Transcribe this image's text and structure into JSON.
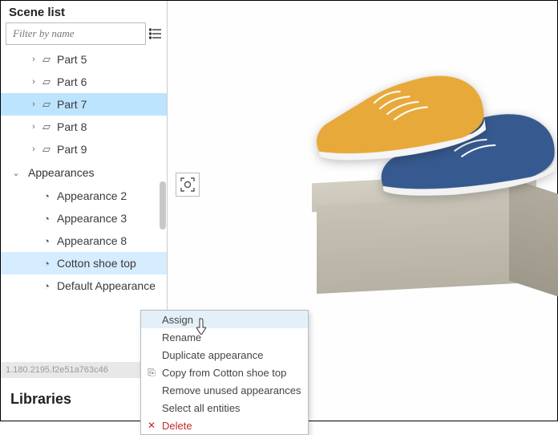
{
  "sidebar": {
    "title": "Scene list",
    "filter_placeholder": "Filter by name",
    "parts": [
      {
        "label": "Part 5"
      },
      {
        "label": "Part 6"
      },
      {
        "label": "Part 7",
        "selected": true
      },
      {
        "label": "Part 8"
      },
      {
        "label": "Part 9"
      }
    ],
    "appearances_header": "Appearances",
    "appearances": [
      {
        "label": "Appearance 2"
      },
      {
        "label": "Appearance 3"
      },
      {
        "label": "Appearance 8"
      },
      {
        "label": "Cotton shoe top",
        "selected": true
      },
      {
        "label": "Default Appearance"
      }
    ],
    "version": "1.180.2195.f2e51a763c46",
    "libraries_title": "Libraries"
  },
  "context_menu": {
    "items": [
      {
        "label": "Assign",
        "highlight": true
      },
      {
        "label": "Rename"
      },
      {
        "label": "Duplicate appearance"
      },
      {
        "label": "Copy from Cotton shoe top",
        "icon": "copy"
      },
      {
        "label": "Remove unused appearances"
      },
      {
        "label": "Select all entities"
      },
      {
        "label": "Delete",
        "danger": true,
        "icon": "close"
      }
    ]
  },
  "tool": {
    "focus_label": "focus-selection"
  },
  "colors": {
    "selection": "#bde4ff",
    "shoe_front": "#e7a93a",
    "shoe_back": "#3a5b93"
  }
}
